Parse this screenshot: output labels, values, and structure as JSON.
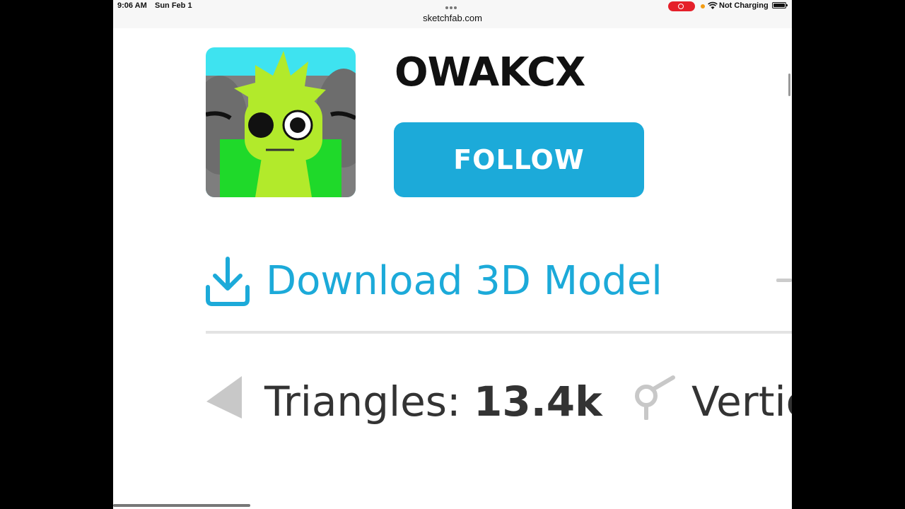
{
  "status_bar": {
    "time": "9:06 AM",
    "date": "Sun Feb 1",
    "url": "sketchfab.com",
    "charging": "Not Charging"
  },
  "profile": {
    "username": "OWAKCX",
    "follow_label": "FOLLOW"
  },
  "download": {
    "label": "Download 3D Model",
    "icon": "download-icon"
  },
  "stats": {
    "triangles_label": "Triangles: ",
    "triangles_value": "13.4k",
    "vertices_label": "Vertic"
  },
  "colors": {
    "accent": "#1caad9",
    "text": "#111111",
    "stat_text": "#333333"
  }
}
